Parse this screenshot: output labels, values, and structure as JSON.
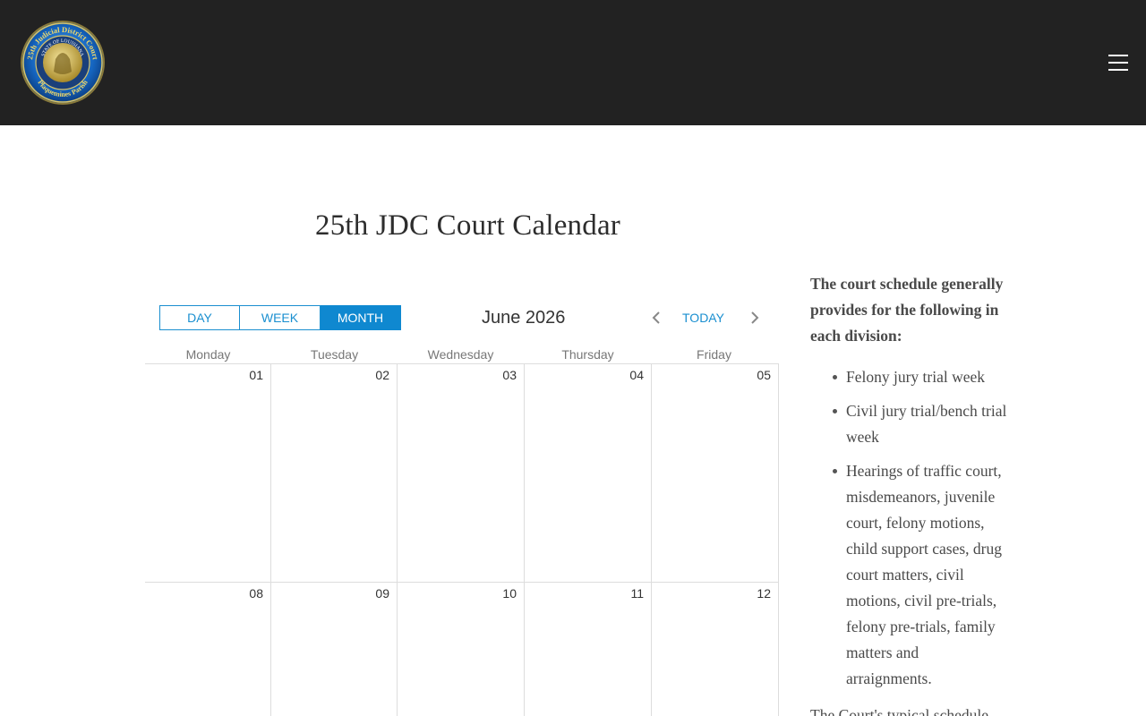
{
  "header": {
    "logo_alt": "25th Judicial District Court seal",
    "logo_text_top": "25th Judicial District Court",
    "logo_text_inner": "STATE OF LOUISIANA",
    "logo_text_bottom": "Plaquemines Parish",
    "logo_accent": "#1565c0",
    "bar_color": "#222222"
  },
  "page": {
    "title": "25th JDC Court Calendar"
  },
  "calendar": {
    "views": [
      "DAY",
      "WEEK",
      "MONTH"
    ],
    "active_view": "MONTH",
    "month_label": "June 2026",
    "today_label": "TODAY",
    "prev_icon": "chevron-left-icon",
    "next_icon": "chevron-right-icon",
    "weekdays": [
      "Monday",
      "Tuesday",
      "Wednesday",
      "Thursday",
      "Friday"
    ],
    "weeks": [
      [
        "01",
        "02",
        "03",
        "04",
        "05"
      ],
      [
        "08",
        "09",
        "10",
        "11",
        "12"
      ]
    ],
    "accent_color": "#0f88d0"
  },
  "sidebar": {
    "intro": "The court schedule generally provides for the following in each division:",
    "items": [
      "Felony jury trial week",
      "Civil jury trial/bench trial week",
      "Hearings of traffic court, misdemeanors, juvenile court, felony motions, child support cases, drug court matters, civil motions, civil pre-trials, felony pre-trials, family matters and arraignments."
    ],
    "outro": "The Court's typical schedule"
  }
}
